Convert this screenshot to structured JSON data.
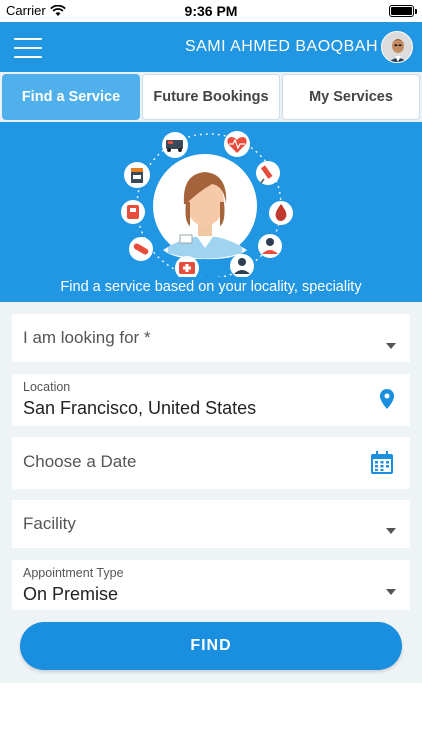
{
  "status_bar": {
    "carrier": "Carrier",
    "time": "9:36 PM"
  },
  "header": {
    "user_name": "SAMI AHMED BAOQBAH"
  },
  "tabs": [
    {
      "label": "Find a Service",
      "active": true
    },
    {
      "label": "Future Bookings",
      "active": false
    },
    {
      "label": "My Services",
      "active": false
    }
  ],
  "hero": {
    "caption": "Find a service based on your locality, speciality"
  },
  "form": {
    "looking_for": {
      "label": "I am looking for *"
    },
    "location": {
      "label": "Location",
      "value": "San Francisco, United States"
    },
    "date": {
      "label": "Choose a Date"
    },
    "facility": {
      "label": "Facility"
    },
    "appointment_type": {
      "label": "Appointment Type",
      "value": "On Premise"
    },
    "find_label": "FIND"
  },
  "colors": {
    "primary": "#2196e3",
    "active_tab": "#4fb0ec",
    "button": "#1a8fe0",
    "form_bg": "#eef3f6"
  }
}
